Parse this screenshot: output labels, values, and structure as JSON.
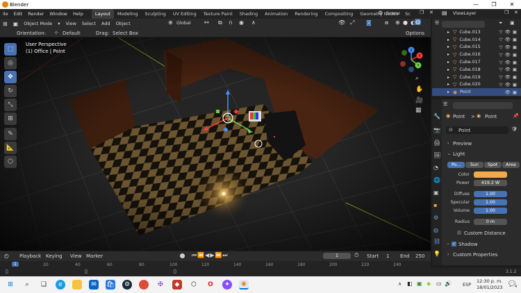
{
  "window": {
    "title": "Blender",
    "min": "—",
    "max": "❐",
    "close": "✕"
  },
  "menubar": {
    "items": [
      "ile",
      "Edit",
      "Render",
      "Window",
      "Help"
    ],
    "tabs": [
      "Layout",
      "Modeling",
      "Sculpting",
      "UV Editing",
      "Texture Paint",
      "Shading",
      "Animation",
      "Rendering",
      "Compositing",
      "Geometry Nodes",
      "Sc"
    ],
    "scene": "Scene",
    "view_layer": "ViewLayer"
  },
  "toolbar": {
    "mode": "Object Mode",
    "menus": [
      "View",
      "Select",
      "Add",
      "Object"
    ],
    "transform": "Global",
    "options": "Options"
  },
  "header2": {
    "orientation_label": "Orientation:",
    "orientation": "Default",
    "drag_label": "Drag:",
    "drag": "Select Box"
  },
  "viewport": {
    "line1": "User Perspective",
    "line2": "(1) Office | Point",
    "axis_x": "X",
    "axis_y": "Y",
    "axis_z": "Z"
  },
  "outliner": {
    "items": [
      {
        "name": "Cube.013",
        "selected": false
      },
      {
        "name": "Cube.014",
        "selected": false
      },
      {
        "name": "Cube.015",
        "selected": false
      },
      {
        "name": "Cube.016",
        "selected": false
      },
      {
        "name": "Cube.017",
        "selected": false
      },
      {
        "name": "Cube.018",
        "selected": false
      },
      {
        "name": "Cube.019",
        "selected": false
      },
      {
        "name": "Cube.020",
        "selected": false
      },
      {
        "name": "Point",
        "selected": true
      }
    ]
  },
  "properties": {
    "breadcrumb_a": "Point",
    "breadcrumb_sep": ">",
    "breadcrumb_b": "Point",
    "data_name": "Point",
    "sections": {
      "preview": "Preview",
      "light": "Light",
      "custom_distance": "Custom Distance",
      "shadow": "Shadow",
      "custom_properties": "Custom Properties"
    },
    "light_types": [
      "Po...",
      "Sun",
      "Spot",
      "Area"
    ],
    "fields": {
      "color_label": "Color",
      "color_value": "#f2a94a",
      "power_label": "Power",
      "power_value": "419.2 W",
      "diffuse_label": "Diffuse",
      "diffuse_value": "1.00",
      "specular_label": "Specular",
      "specular_value": "1.00",
      "volume_label": "Volume",
      "volume_value": "1.00",
      "radius_label": "Radius",
      "radius_value": "0 m"
    }
  },
  "timeline": {
    "menus": [
      "Playback",
      "Keying",
      "View",
      "Marker"
    ],
    "current": "1",
    "start_label": "Start",
    "start": "1",
    "end_label": "End",
    "end": "250",
    "ruler": [
      "20",
      "40",
      "60",
      "80",
      "100",
      "120",
      "140",
      "160",
      "180",
      "200",
      "220",
      "240"
    ],
    "frame_indicator": "1"
  },
  "statusbar": {
    "version": "3.1.2"
  },
  "taskbar": {
    "lang": "ESP",
    "time": "12:30 p. m.",
    "date": "18/01/2023",
    "notif_count": "4"
  }
}
